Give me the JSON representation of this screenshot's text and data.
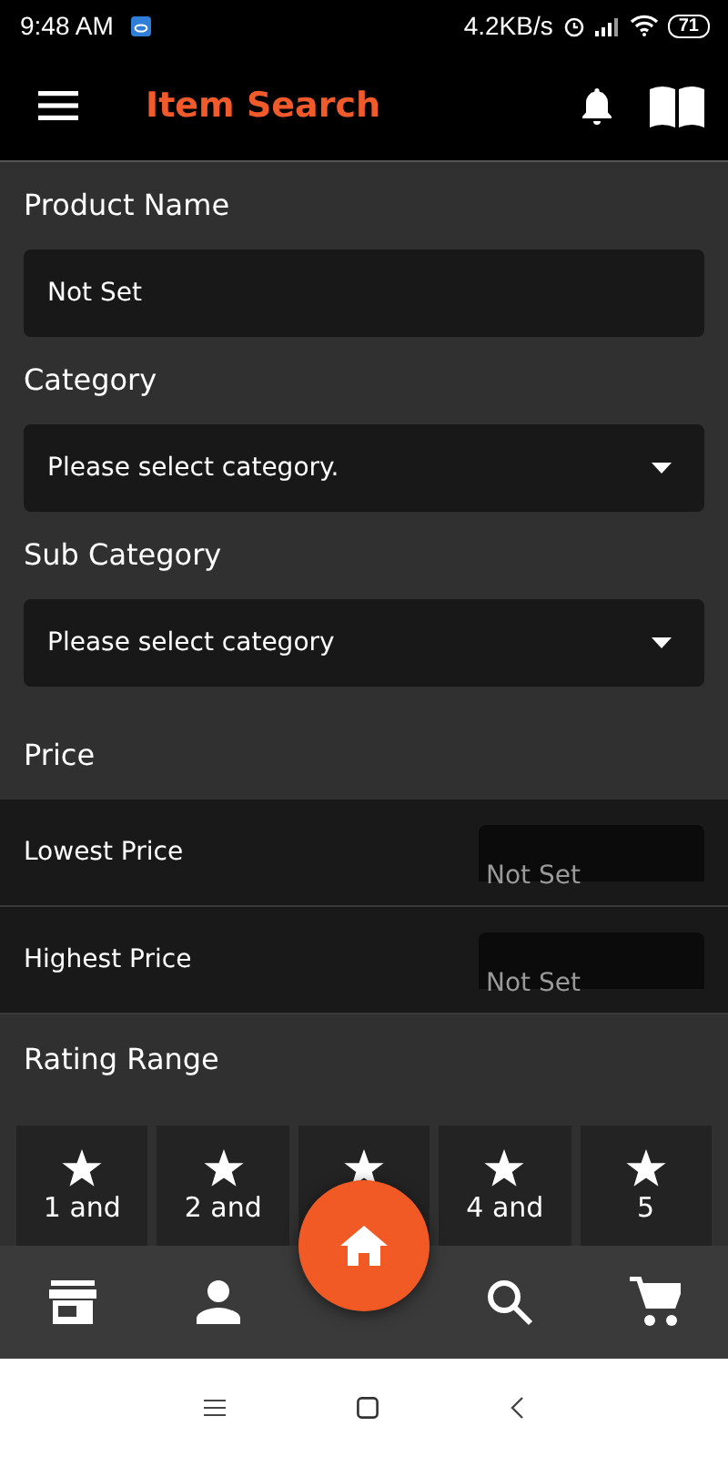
{
  "status_bar": {
    "time": "9:48 AM",
    "speed": "4.2KB/s",
    "battery": "71"
  },
  "app_bar": {
    "title": "Item Search"
  },
  "fields": [
    {
      "label": "Product Name",
      "value": "Not Set",
      "kind": "text"
    },
    {
      "label": "Category",
      "value": "Please select category.",
      "kind": "dropdown"
    },
    {
      "label": "Sub Category",
      "value": "Please select category",
      "kind": "dropdown"
    }
  ],
  "price": {
    "title": "Price",
    "rows": [
      {
        "label": "Lowest Price",
        "placeholder": "Not Set"
      },
      {
        "label": "Highest Price",
        "placeholder": "Not Set"
      }
    ]
  },
  "rating": {
    "title": "Rating Range",
    "options": [
      {
        "kind": "rating",
        "label": "1 and"
      },
      {
        "kind": "rating",
        "label": "2 and"
      },
      {
        "kind": "rating"
      },
      {
        "kind": "rating",
        "label": "4 and"
      },
      {
        "kind": "rating",
        "label": "5"
      }
    ]
  },
  "bottom_nav": {
    "items": [
      {
        "kind": "store"
      },
      {
        "kind": "person"
      },
      {
        "kind": "home"
      },
      {
        "kind": "search"
      },
      {
        "kind": "cart"
      }
    ]
  }
}
